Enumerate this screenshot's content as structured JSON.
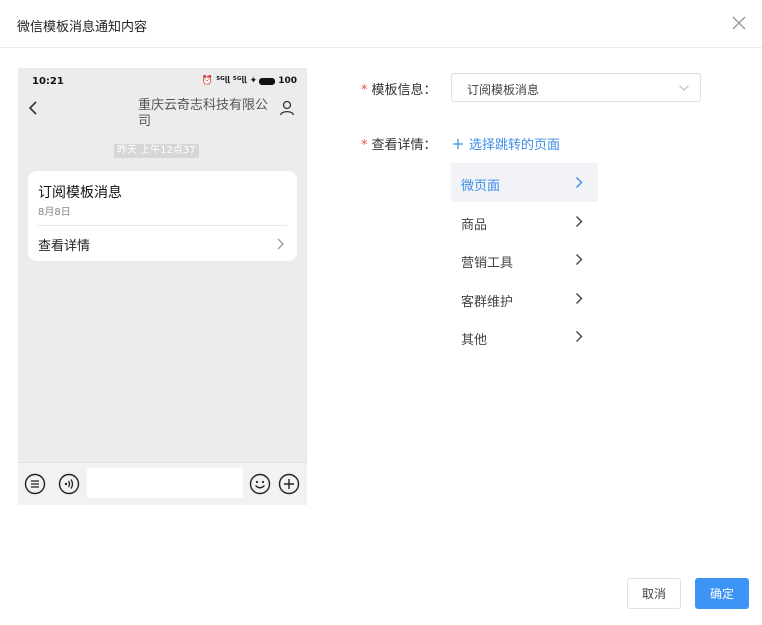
{
  "dialog": {
    "title": "微信模板消息通知内容"
  },
  "phone": {
    "status_time": "10:21",
    "status_signal": "⏰ ⁵ᴳ𝗅𝗅 ⁵ᴳ𝗅𝗅 ✦",
    "battery_level": "100",
    "chat_title": "重庆云奇志科技有限公司",
    "time_tag": "昨天 上午12点37",
    "message": {
      "title": "订阅模板消息",
      "date": "8月8日",
      "detail_label": "查看详情"
    }
  },
  "form": {
    "template_label": "模板信息：",
    "template_value": "订阅模板消息",
    "detail_label": "查看详情：",
    "add_link_label": "选择跳转的页面",
    "menu_items": [
      {
        "label": "微页面",
        "active": true
      },
      {
        "label": "商品",
        "active": false
      },
      {
        "label": "营销工具",
        "active": false
      },
      {
        "label": "客群维护",
        "active": false
      },
      {
        "label": "其他",
        "active": false
      }
    ]
  },
  "buttons": {
    "cancel_label": "取消",
    "ok_label": "确定"
  },
  "colors": {
    "accent": "#3d8ee8",
    "primary_button": "#3d94f6",
    "required": "#e85353"
  }
}
